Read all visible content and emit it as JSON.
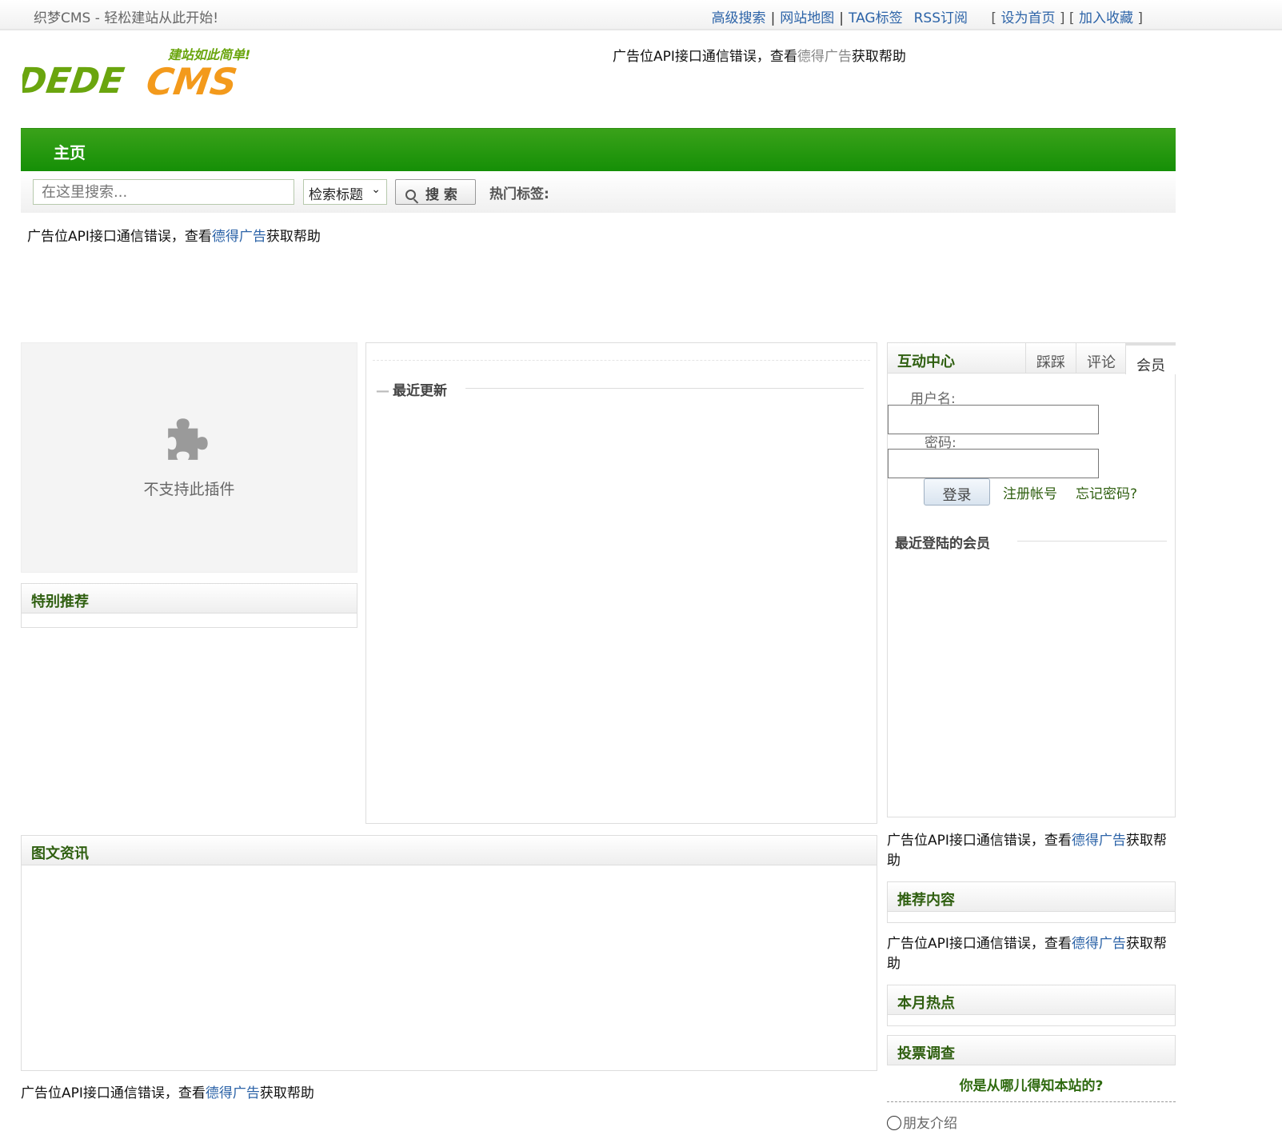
{
  "topbar": {
    "welcome": "织梦CMS - 轻松建站从此开始!",
    "links": [
      "高级搜索",
      "网站地图",
      "TAG标签",
      "RSS订阅"
    ],
    "set_home": "设为首页",
    "add_fav": "加入收藏"
  },
  "logo": {
    "main_left": "DEDE",
    "main_right": "CMS",
    "slogan": "建站如此简单!"
  },
  "ad": {
    "prefix": "广告位API接口通信错误，查看",
    "link": "德得广告",
    "suffix": "获取帮助"
  },
  "nav": {
    "home": "主页"
  },
  "search": {
    "placeholder": "在这里搜索...",
    "select_value": "检索标题",
    "button": "搜 索",
    "hot_tags": "热门标签:"
  },
  "plugin": {
    "message": "不支持此插件"
  },
  "boxes": {
    "special": "特别推荐",
    "latest": "最近更新",
    "picnews": "图文资讯",
    "recommend": "推荐内容",
    "hotmonth": "本月热点",
    "vote": "投票调查"
  },
  "interact": {
    "title": "互动中心",
    "tabs": [
      "踩踩",
      "评论",
      "会员"
    ],
    "active_tab": "会员",
    "username_label": "用户名:",
    "password_label": "密码:",
    "login": "登录",
    "register": "注册帐号",
    "forgot": "忘记密码?",
    "recent_members": "最近登陆的会员"
  },
  "vote": {
    "question": "你是从哪儿得知本站的?",
    "option1": "朋友介绍"
  },
  "colors": {
    "nav_green": "#1a920a",
    "link_blue": "#2d64a8",
    "heading_green": "#2f5f10",
    "logo_green": "#6aa50e",
    "logo_orange": "#f39a1c"
  }
}
